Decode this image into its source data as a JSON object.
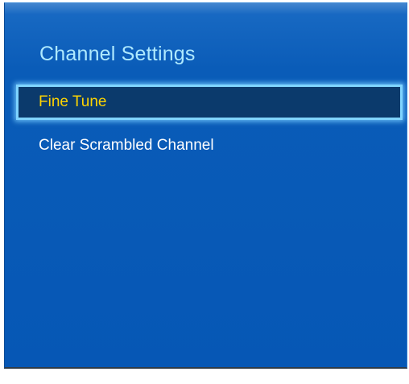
{
  "menu": {
    "title": "Channel Settings",
    "items": [
      {
        "label": "Fine Tune",
        "selected": true
      },
      {
        "label": "Clear Scrambled Channel",
        "selected": false
      }
    ]
  },
  "colors": {
    "panel_bg": "#0657b5",
    "title_text": "#aee9ff",
    "item_text": "#ffffff",
    "selected_text": "#ffd400",
    "selected_bg": "#0b3a6c",
    "selected_border": "#7fd4ff"
  }
}
